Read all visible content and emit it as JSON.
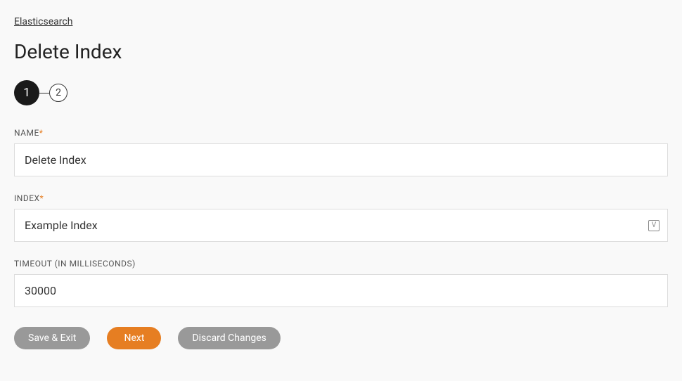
{
  "breadcrumb": {
    "parent": "Elasticsearch"
  },
  "page": {
    "title": "Delete Index"
  },
  "stepper": {
    "steps": [
      "1",
      "2"
    ],
    "active": 0
  },
  "form": {
    "name": {
      "label": "NAME",
      "required": "*",
      "value": "Delete Index"
    },
    "index": {
      "label": "INDEX",
      "required": "*",
      "value": "Example Index"
    },
    "timeout": {
      "label": "TIMEOUT (IN MILLISECONDS)",
      "value": "30000"
    }
  },
  "buttons": {
    "save_exit": "Save & Exit",
    "next": "Next",
    "discard": "Discard Changes"
  }
}
